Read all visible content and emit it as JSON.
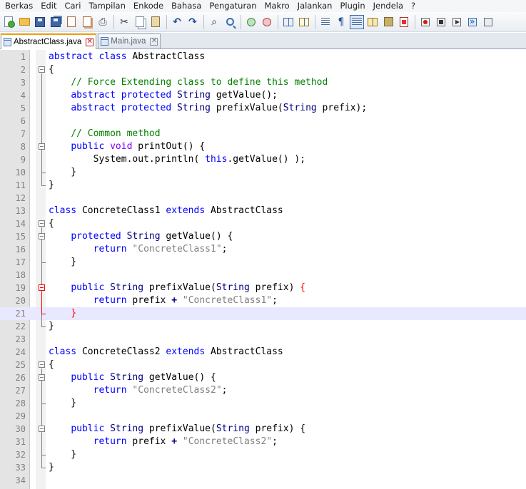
{
  "menu": [
    "Berkas",
    "Edit",
    "Cari",
    "Tampilan",
    "Enkode",
    "Bahasa",
    "Pengaturan",
    "Makro",
    "Jalankan",
    "Plugin",
    "Jendela",
    "?"
  ],
  "toolbar": {
    "icons": [
      "new-file-icon",
      "open-folder-icon",
      "save-icon",
      "save-all-icon",
      "close-icon",
      "close-all-icon",
      "print-icon",
      "cut-icon",
      "copy-icon",
      "paste-icon",
      "undo-icon",
      "redo-icon",
      "find-icon",
      "replace-icon",
      "zoom-in-icon",
      "zoom-out-icon",
      "sync-scroll-icon",
      "word-wrap-icon",
      "show-all-chars-icon",
      "indent-guide-icon",
      "user-language-icon",
      "document-map-icon",
      "pdf-icon",
      "macro-record-icon",
      "macro-stop-icon",
      "macro-play-icon",
      "macro-run-multiple-icon",
      "macro-save-icon"
    ]
  },
  "tabs": [
    {
      "label": "AbstractClass.java",
      "active": true
    },
    {
      "label": "Main.java",
      "active": false
    }
  ],
  "editor": {
    "current_line": 21,
    "lines": [
      {
        "n": "1",
        "text": "abstract class AbstractClass"
      },
      {
        "n": "2",
        "text": "{"
      },
      {
        "n": "3",
        "text": "    // Force Extending class to define this method"
      },
      {
        "n": "4",
        "text": "    abstract protected String getValue();"
      },
      {
        "n": "5",
        "text": "    abstract protected String prefixValue(String prefix);"
      },
      {
        "n": "6",
        "text": ""
      },
      {
        "n": "7",
        "text": "    // Common method"
      },
      {
        "n": "8",
        "text": "    public void printOut() {"
      },
      {
        "n": "9",
        "text": "        System.out.println( this.getValue() );"
      },
      {
        "n": "10",
        "text": "    }"
      },
      {
        "n": "11",
        "text": "}"
      },
      {
        "n": "12",
        "text": ""
      },
      {
        "n": "13",
        "text": "class ConcreteClass1 extends AbstractClass"
      },
      {
        "n": "14",
        "text": "{"
      },
      {
        "n": "15",
        "text": "    protected String getValue() {"
      },
      {
        "n": "16",
        "text": "        return \"ConcreteClass1\";"
      },
      {
        "n": "17",
        "text": "    }"
      },
      {
        "n": "18",
        "text": ""
      },
      {
        "n": "19",
        "text": "    public String prefixValue(String prefix) {"
      },
      {
        "n": "20",
        "text": "        return prefix + \"ConcreteClass1\";"
      },
      {
        "n": "21",
        "text": "    }"
      },
      {
        "n": "22",
        "text": "}"
      },
      {
        "n": "23",
        "text": ""
      },
      {
        "n": "24",
        "text": "class ConcreteClass2 extends AbstractClass"
      },
      {
        "n": "25",
        "text": "{"
      },
      {
        "n": "26",
        "text": "    public String getValue() {"
      },
      {
        "n": "27",
        "text": "        return \"ConcreteClass2\";"
      },
      {
        "n": "28",
        "text": "    }"
      },
      {
        "n": "29",
        "text": ""
      },
      {
        "n": "30",
        "text": "    public String prefixValue(String prefix) {"
      },
      {
        "n": "31",
        "text": "        return prefix + \"ConcreteClass2\";"
      },
      {
        "n": "32",
        "text": "    }"
      },
      {
        "n": "33",
        "text": "}"
      },
      {
        "n": "34",
        "text": ""
      }
    ]
  },
  "colors": {
    "keyword": "#0000ff",
    "type_keyword": "#8000ff",
    "comment": "#008000",
    "string": "#808080",
    "current_line": "#e8e8ff",
    "brace_highlight": "#ff0000",
    "active_tab_accent": "#f0a30a"
  }
}
